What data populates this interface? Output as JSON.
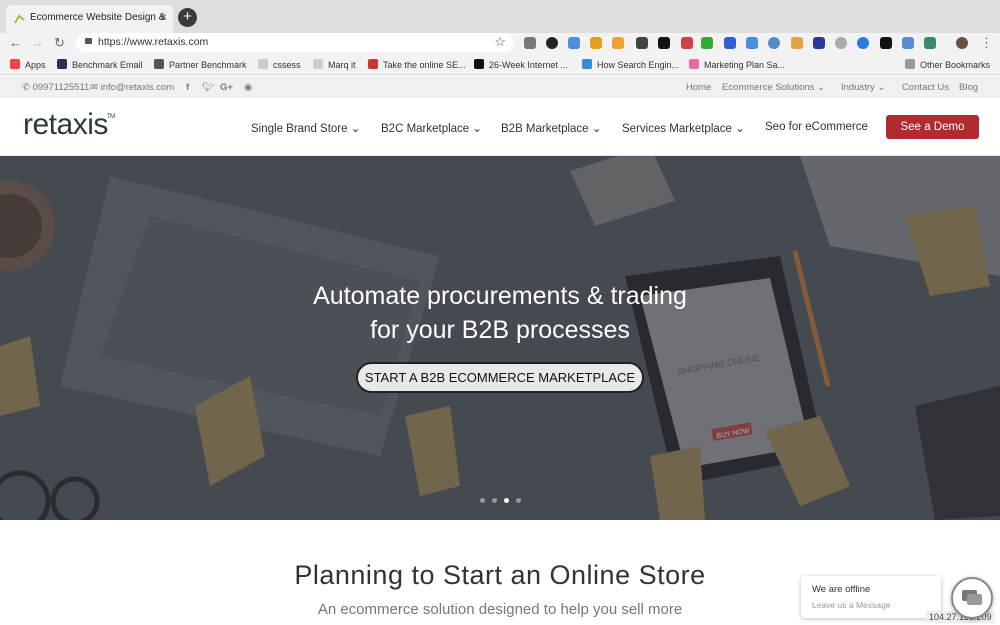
{
  "browser": {
    "tab_title": "Ecommerce Website Design &",
    "url": "https://www.retaxis.com",
    "bookmarks": [
      "Apps",
      "Benchmark Email",
      "Partner Benchmark",
      "cssess",
      "Marq it",
      "Take the online SE...",
      "26-Week Internet ...",
      "How Search Engin...",
      "Marketing Plan Sa..."
    ],
    "other_bookmarks": "Other Bookmarks"
  },
  "topbar": {
    "phone": "09971125511",
    "email": "info@retaxis.com",
    "links": [
      "Home",
      "Ecommerce Solutions",
      "Industry",
      "Contact Us",
      "Blog"
    ]
  },
  "header": {
    "logo": "retaxis",
    "tm": "TM",
    "menu": [
      "Single Brand Store",
      "B2C Marketplace",
      "B2B Marketplace",
      "Services Marketplace",
      "Seo for eCommerce"
    ],
    "demo_label": "See a Demo"
  },
  "hero": {
    "title_line1": "Automate procurements & trading",
    "title_line2": "for your B2B processes",
    "cta": "START A B2B ECOMMERCE MARKETPLACE",
    "slides": 4,
    "active_slide": 3,
    "illustration": {
      "shopping_online": "SHOPPING ONLINE",
      "buy_now": "BUY NOW"
    }
  },
  "section": {
    "title": "Planning to Start an Online Store",
    "subtitle": "An ecommerce solution designed to help you sell more"
  },
  "chat": {
    "status": "We are offline",
    "prompt": "Leave us a Message"
  },
  "ip_label": "104.27.138.209"
}
